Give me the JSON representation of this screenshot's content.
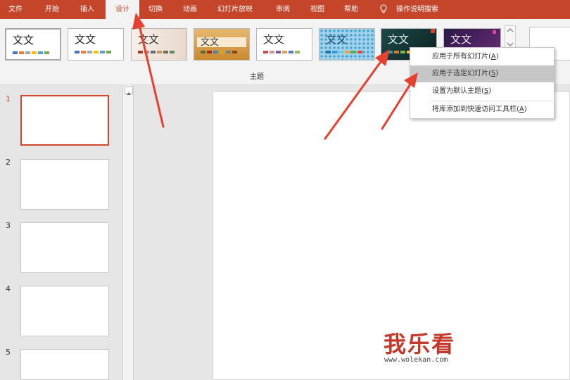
{
  "tabs": [
    {
      "label": "文件"
    },
    {
      "label": "开始"
    },
    {
      "label": "插入"
    },
    {
      "label": "设计"
    },
    {
      "label": "切换"
    },
    {
      "label": "动画"
    },
    {
      "label": "幻灯片放映"
    },
    {
      "label": "审阅"
    },
    {
      "label": "视图"
    },
    {
      "label": "帮助"
    },
    {
      "label": "操作说明搜索"
    }
  ],
  "ribbon": {
    "group_label": "主题",
    "thumb_text": "文文"
  },
  "context_menu": {
    "items": [
      {
        "label": "应用于所有幻灯片(",
        "key": "A",
        "suffix": ")"
      },
      {
        "label": "应用于选定幻灯片(",
        "key": "S",
        "suffix": ")"
      },
      {
        "label": "设置为默认主题(",
        "key": "S",
        "suffix": ")"
      },
      {
        "label": "将库添加到快速访问工具栏(",
        "key": "A",
        "suffix": ")"
      }
    ]
  },
  "slides": [
    {
      "number": "1"
    },
    {
      "number": "2"
    },
    {
      "number": "3"
    },
    {
      "number": "4"
    },
    {
      "number": "5"
    }
  ],
  "watermark": {
    "text": "我乐看",
    "url": "www.wolekan.com"
  },
  "colors": {
    "accent": "#c4452a",
    "selection": "#d5472b",
    "arrow": "#e8402f"
  }
}
